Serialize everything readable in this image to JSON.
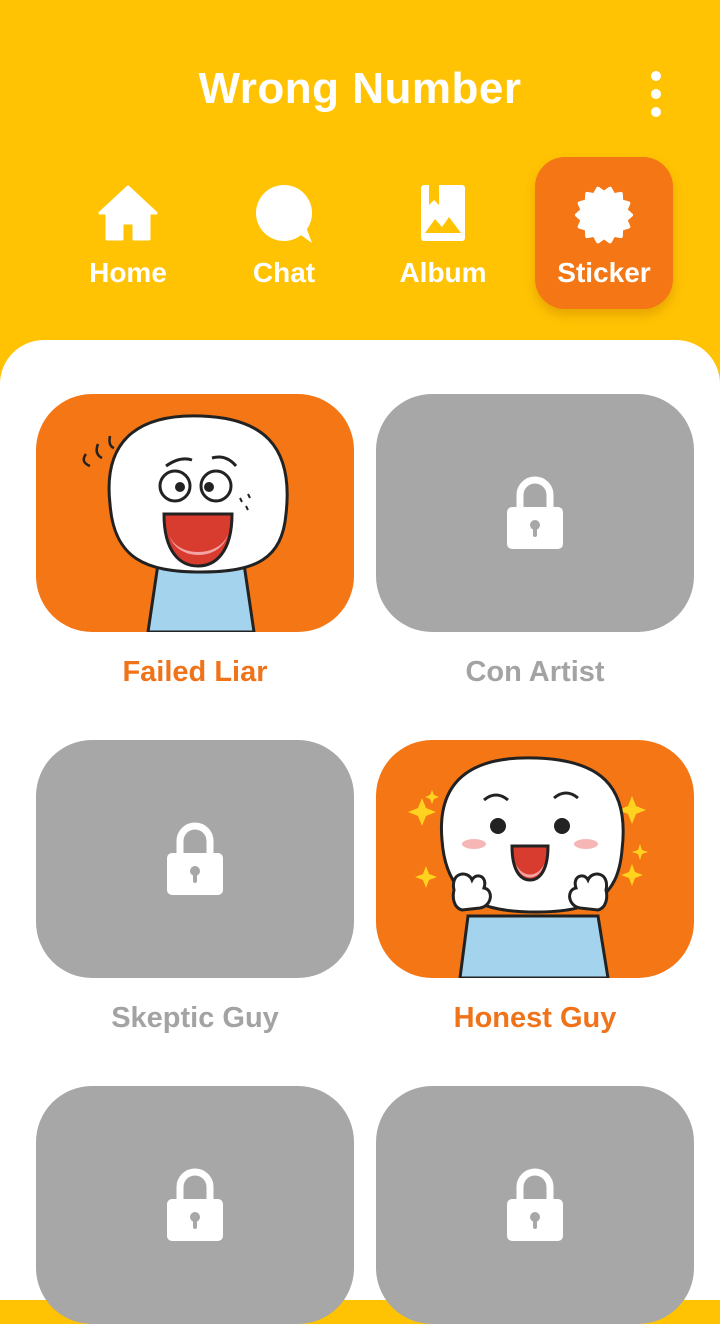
{
  "header": {
    "title": "Wrong Number",
    "menu_icon": "more-vertical-icon"
  },
  "tabs": [
    {
      "label": "Home",
      "icon": "home-icon",
      "active": false
    },
    {
      "label": "Chat",
      "icon": "chat-bubble-icon",
      "active": false
    },
    {
      "label": "Album",
      "icon": "album-icon",
      "active": false
    },
    {
      "label": "Sticker",
      "icon": "sticker-badge-icon",
      "active": true
    }
  ],
  "stickers": [
    {
      "name": "Failed Liar",
      "locked": false
    },
    {
      "name": "Con Artist",
      "locked": true
    },
    {
      "name": "Skeptic Guy",
      "locked": true
    },
    {
      "name": "Honest Guy",
      "locked": false
    },
    {
      "name": "",
      "locked": true
    },
    {
      "name": "",
      "locked": true
    }
  ],
  "colors": {
    "header_bg": "#FFC303",
    "accent": "#F47614",
    "locked_card": "#A7A7A7",
    "locked_text": "#A3A3A3",
    "unlocked_text": "#F07219"
  }
}
